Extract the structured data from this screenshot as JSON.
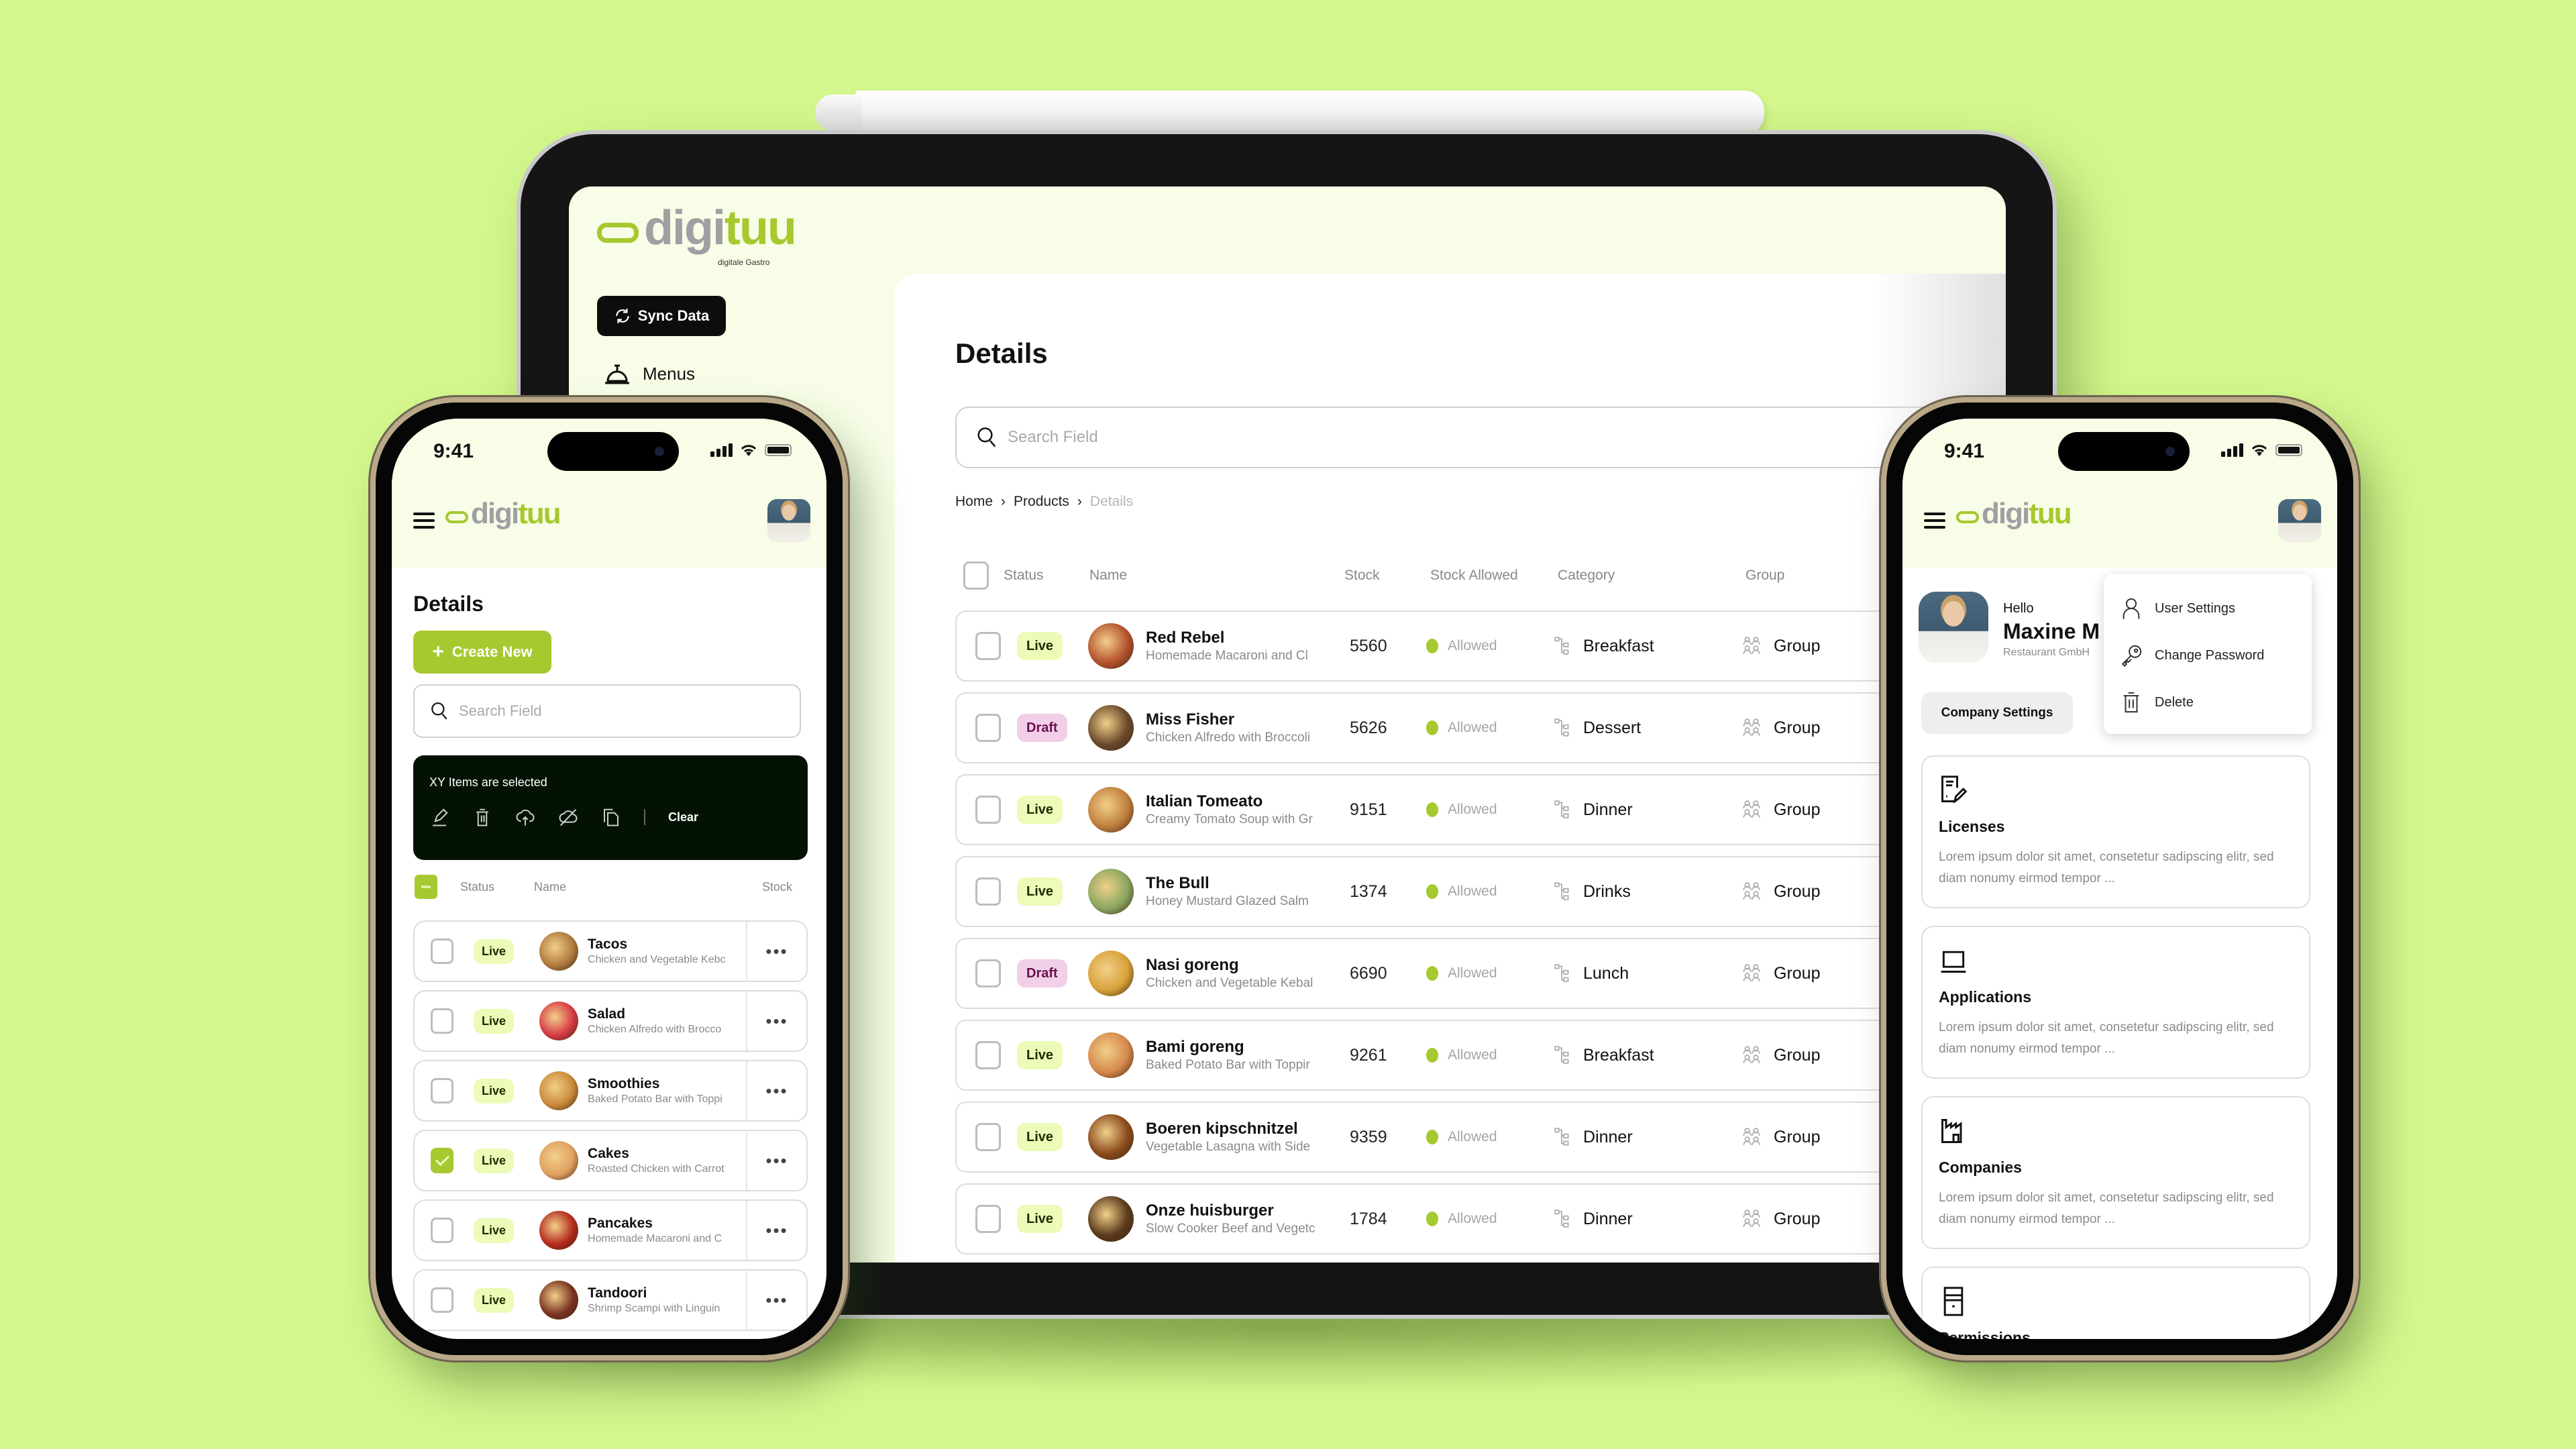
{
  "brand": {
    "name_part1": "digi",
    "name_part2": "tuu",
    "tagline": "digitale Gastro",
    "accent_color": "#a5c92e",
    "background_color": "#d3f78c"
  },
  "tablet": {
    "sidebar": {
      "sync_button": "Sync Data",
      "nav_items": [
        {
          "label": "Menus",
          "icon": "bell-icon"
        }
      ]
    },
    "main": {
      "title": "Details",
      "search_placeholder": "Search Field",
      "breadcrumb": [
        "Home",
        "Products",
        "Details"
      ],
      "columns": [
        "Status",
        "Name",
        "Stock",
        "Stock Allowed",
        "Category",
        "Group"
      ],
      "rows": [
        {
          "status": "Live",
          "name": "Red Rebel",
          "desc": "Homemade Macaroni and Cl",
          "stock": "5560",
          "allowed": "Allowed",
          "category": "Breakfast",
          "group": "Group",
          "img": "#b5522e"
        },
        {
          "status": "Draft",
          "name": "Miss Fisher",
          "desc": "Chicken Alfredo with Broccoli",
          "stock": "5626",
          "allowed": "Allowed",
          "category": "Dessert",
          "group": "Group",
          "img": "#6a4a2b"
        },
        {
          "status": "Live",
          "name": "Italian Tomeato",
          "desc": "Creamy Tomato Soup with Gr",
          "stock": "9151",
          "allowed": "Allowed",
          "category": "Dinner",
          "group": "Group",
          "img": "#c0803e"
        },
        {
          "status": "Live",
          "name": "The Bull",
          "desc": "Honey Mustard Glazed Salm",
          "stock": "1374",
          "allowed": "Allowed",
          "category": "Drinks",
          "group": "Group",
          "img": "#8aa760"
        },
        {
          "status": "Draft",
          "name": "Nasi goreng",
          "desc": "Chicken and Vegetable Kebal",
          "stock": "6690",
          "allowed": "Allowed",
          "category": "Lunch",
          "group": "Group",
          "img": "#d9a23a"
        },
        {
          "status": "Live",
          "name": "Bami goreng",
          "desc": "Baked Potato Bar with Toppir",
          "stock": "9261",
          "allowed": "Allowed",
          "category": "Breakfast",
          "group": "Group",
          "img": "#d7894e"
        },
        {
          "status": "Live",
          "name": "Boeren kipschnitzel",
          "desc": "Vegetable Lasagna with Side",
          "stock": "9359",
          "allowed": "Allowed",
          "category": "Dinner",
          "group": "Group",
          "img": "#8b4a1e"
        },
        {
          "status": "Live",
          "name": "Onze huisburger",
          "desc": "Slow Cooker Beef and Vegetc",
          "stock": "1784",
          "allowed": "Allowed",
          "category": "Dinner",
          "group": "Group",
          "img": "#5a3a1c"
        }
      ]
    }
  },
  "phone_left": {
    "time": "9:41",
    "title": "Details",
    "create_button": "Create New",
    "search_placeholder": "Search Field",
    "selection": {
      "text": "XY Items are selected",
      "clear_label": "Clear",
      "actions": [
        "edit-icon",
        "trash-icon",
        "upload-cloud-icon",
        "cloud-off-icon",
        "copy-icon"
      ]
    },
    "columns": [
      "Status",
      "Name",
      "Stock"
    ],
    "rows": [
      {
        "status": "Live",
        "name": "Tacos",
        "desc": "Chicken and Vegetable Kebc",
        "checked": false,
        "img": "#b07a3e"
      },
      {
        "status": "Live",
        "name": "Salad",
        "desc": "Chicken Alfredo with Brocco",
        "checked": false,
        "img": "#d63a45"
      },
      {
        "status": "Live",
        "name": "Smoothies",
        "desc": "Baked Potato Bar with Toppi",
        "checked": false,
        "img": "#c98a3a"
      },
      {
        "status": "Live",
        "name": "Cakes",
        "desc": "Roasted Chicken with Carrot",
        "checked": true,
        "img": "#e0a060"
      },
      {
        "status": "Live",
        "name": "Pancakes",
        "desc": "Homemade Macaroni and C",
        "checked": false,
        "img": "#b52a1e"
      },
      {
        "status": "Live",
        "name": "Tandoori",
        "desc": "Shrimp Scampi with Linguin",
        "checked": false,
        "img": "#7a3320"
      }
    ]
  },
  "phone_right": {
    "time": "9:41",
    "greeting": "Hello",
    "user_name": "Maxine M",
    "company": "Restaurant GmbH",
    "company_settings_button": "Company Settings",
    "dropdown": [
      {
        "label": "User Settings",
        "icon": "user-icon"
      },
      {
        "label": "Change Password",
        "icon": "key-icon"
      },
      {
        "label": "Delete",
        "icon": "trash-icon"
      }
    ],
    "cards": [
      {
        "title": "Licenses",
        "desc": "Lorem ipsum dolor sit amet, consetetur sadipscing elitr, sed diam nonumy eirmod tempor ...",
        "icon": "license-icon"
      },
      {
        "title": "Applications",
        "desc": "Lorem ipsum dolor sit amet, consetetur sadipscing elitr, sed diam nonumy eirmod tempor ...",
        "icon": "laptop-icon"
      },
      {
        "title": "Companies",
        "desc": "Lorem ipsum dolor sit amet, consetetur sadipscing elitr, sed diam nonumy eirmod tempor ...",
        "icon": "factory-icon"
      },
      {
        "title": "Permissions",
        "desc": "",
        "icon": "cabinet-icon"
      }
    ]
  }
}
